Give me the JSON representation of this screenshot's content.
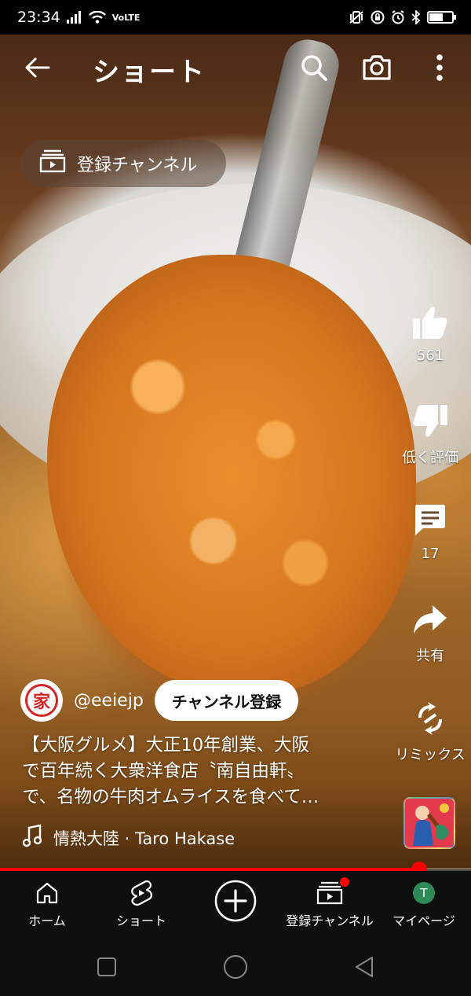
{
  "status_bar": {
    "time": "23:34",
    "network": "VoLTE",
    "icons": [
      "signal-icon",
      "wifi-icon",
      "vibrate-icon",
      "lock-rotation-icon",
      "alarm-icon",
      "bluetooth-icon",
      "battery-icon"
    ],
    "battery_level": 0.55
  },
  "header": {
    "title": "ショート",
    "icons": [
      "back-arrow-icon",
      "search-icon",
      "camera-icon",
      "more-vert-icon"
    ]
  },
  "subscriptions_chip": {
    "label": "登録チャンネル",
    "icon": "subscriptions-icon"
  },
  "actions": {
    "like": {
      "icon": "thumb-up-icon",
      "label": "561"
    },
    "dislike": {
      "icon": "thumb-down-icon",
      "label": "低く評価"
    },
    "comments": {
      "icon": "comment-icon",
      "label": "17"
    },
    "share": {
      "icon": "share-icon",
      "label": "共有"
    },
    "remix": {
      "icon": "remix-icon",
      "label": "リミックス"
    }
  },
  "channel": {
    "handle": "@eeiejp",
    "logo_text": "家",
    "subscribe_label": "チャンネル登録"
  },
  "video": {
    "caption_lines": [
      "【大阪グルメ】大正10年創業、大阪",
      "で百年続く大衆洋食店〝南自由軒〟",
      "で、名物の牛肉オムライスを食べて…"
    ],
    "music": "情熱大陸 · Taro Hakase",
    "progress": 0.89
  },
  "bottom_nav": [
    {
      "label": "ホーム",
      "icon": "home-icon"
    },
    {
      "label": "ショート",
      "icon": "shorts-icon"
    },
    {
      "label": "",
      "icon": "create-plus-icon"
    },
    {
      "label": "登録チャンネル",
      "icon": "subscriptions-icon",
      "badge": true
    },
    {
      "label": "マイページ",
      "icon": "avatar",
      "avatar_letter": "T"
    }
  ],
  "colors": {
    "accent": "#ff0000",
    "nav_bg": "#0f0f0f",
    "avatar_bg": "#2e8b57"
  }
}
